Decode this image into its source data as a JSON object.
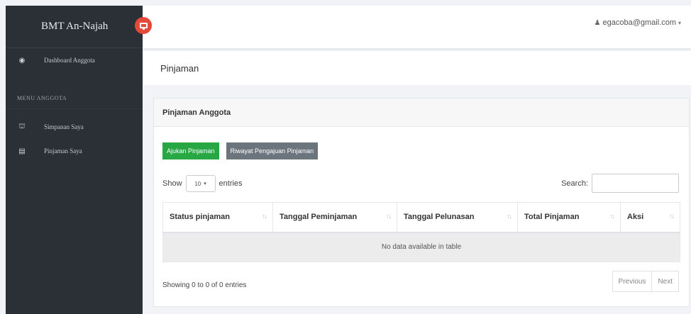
{
  "brand": "BMT An-Najah",
  "sidebar": {
    "items": [
      {
        "label": "Dashboard Anggota",
        "icon": "dashboard-icon"
      }
    ],
    "menu_header": "MENU ANGGOTA",
    "menu_items": [
      {
        "label": "Simpanan Saya",
        "icon": "bank-icon"
      },
      {
        "label": "Pinjaman Saya",
        "icon": "list-icon"
      }
    ]
  },
  "topbar": {
    "toggle_icon": "monitor-icon",
    "user_email": "egacoba@gmail.com"
  },
  "page_title": "Pinjaman",
  "card": {
    "title": "Pinjaman Anggota",
    "buttons": {
      "apply": "Ajukan Pinjaman",
      "history": "Riwayat Pengajuan Pinjaman"
    },
    "show_prefix": "Show",
    "show_value": "10",
    "show_suffix": "entries",
    "search_label": "Search:",
    "search_value": "",
    "table": {
      "headers": [
        "Status pinjaman",
        "Tanggal Peminjaman",
        "Tanggal Pelunasan",
        "Total Pinjaman",
        "Aksi"
      ],
      "empty_message": "No data available in table"
    },
    "info": "Showing 0 to 0 of 0 entries",
    "pager": {
      "previous": "Previous",
      "next": "Next"
    }
  },
  "colors": {
    "sidebar_bg": "#2b3036",
    "toggle_red": "#e5493a",
    "btn_green": "#28a745",
    "btn_gray": "#6c757d"
  }
}
